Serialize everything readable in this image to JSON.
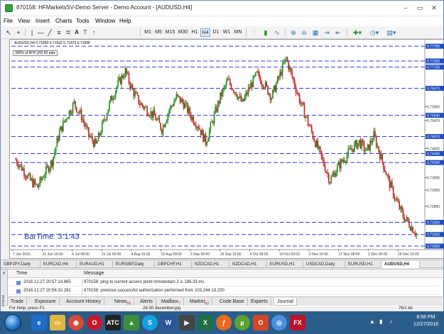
{
  "window": {
    "title": "870158: HFMarketsSV-Demo Server - Demo Account - [AUDUSD,H4]",
    "controls": [
      "–",
      "▭",
      "✕"
    ]
  },
  "menu": [
    "File",
    "View",
    "Insert",
    "Charts",
    "Tools",
    "Window",
    "Help"
  ],
  "toolbar": {
    "timeframes": [
      "M1",
      "M5",
      "M15",
      "M30",
      "H1",
      "H4",
      "D1",
      "W1",
      "MN"
    ],
    "active_timeframe": "H4"
  },
  "chart": {
    "symbol_info": "AUDUSD,H4  0.71890 0.71932 0.71873 0.71898",
    "indicator_label": "300% of ATR (20)   60 pips",
    "bartime_label": "BarTime: 3:1:43",
    "price_labels": [
      "0.77780",
      "0.77320",
      "0.77130",
      "0.76470",
      "0.75900",
      "0.75630",
      "0.75470",
      "0.74970",
      "0.74600",
      "0.74440",
      "0.74160",
      "0.73690",
      "0.73300",
      "0.72800",
      "0.72300",
      "0.71920",
      "0.71560"
    ],
    "highlighted_prices": [
      "0.77780",
      "0.77320",
      "0.77130",
      "0.76470",
      "0.75630",
      "0.74970",
      "0.74440",
      "0.74160",
      "0.72300",
      "0.71920",
      "0.71560"
    ],
    "date_labels": [
      "7 Jun 2016",
      "21 Jun 16:00",
      "6 Jul 08:00",
      "21 Jul 00:00",
      "4 Aug 16:00",
      "19 Aug 08:00",
      "5 Sep 00:00",
      "19 Sep 16:00",
      "4 Oct 08:00",
      "19 Oct 00:00",
      "2 Nov 16:00",
      "17 Nov 08:00",
      "1 Dec 00:00",
      "16 Dec 16:00"
    ],
    "colors": {
      "up_candle": "#1a8c1a",
      "down_candle": "#c22222",
      "level_line": "#3a3ad6",
      "price_highlight": "#1f4fbf"
    },
    "chart_data": {
      "type": "candlestick",
      "symbol": "AUDUSD",
      "timeframe": "H4",
      "x_tick_labels": [
        "7 Jun 2016",
        "21 Jun 16:00",
        "6 Jul 08:00",
        "21 Jul 00:00",
        "4 Aug 16:00",
        "19 Aug 08:00",
        "5 Sep 00:00",
        "19 Sep 16:00",
        "4 Oct 08:00",
        "19 Oct 00:00",
        "2 Nov 16:00",
        "17 Nov 08:00",
        "1 Dec 00:00",
        "16 Dec 16:00"
      ],
      "ylim": [
        0.7145,
        0.7785
      ],
      "approx_close_path": [
        0.7425,
        0.7395,
        0.736,
        0.734,
        0.7385,
        0.742,
        0.751,
        0.756,
        0.76,
        0.756,
        0.75,
        0.747,
        0.754,
        0.761,
        0.766,
        0.77,
        0.764,
        0.76,
        0.758,
        0.756,
        0.752,
        0.758,
        0.762,
        0.76,
        0.756,
        0.753,
        0.748,
        0.755,
        0.762,
        0.767,
        0.764,
        0.76,
        0.765,
        0.769,
        0.766,
        0.762,
        0.768,
        0.774,
        0.767,
        0.76,
        0.754,
        0.748,
        0.742,
        0.736,
        0.74,
        0.743,
        0.746,
        0.748,
        0.745,
        0.75,
        0.743,
        0.736,
        0.73,
        0.725,
        0.722,
        0.719
      ],
      "horizontal_levels": [
        0.7778,
        0.7732,
        0.7713,
        0.7647,
        0.7563,
        0.7497,
        0.7444,
        0.7416,
        0.723,
        0.7192,
        0.7156
      ]
    }
  },
  "symbol_tabs": [
    "GBPJPY,Daily",
    "EURCAD,H4",
    "EURAUD,H1",
    "EURGBP,Daily",
    "GBPCHF,H1",
    "NZDCAD,H1",
    "NZDCAD,H1",
    "EURUSD,H1",
    "USDCAD,Daily",
    "EURUSD,H1",
    "AUDUSD,H4"
  ],
  "active_symbol_tab": "AUDUSD,H4",
  "terminal": {
    "side_label": "Terminal",
    "headers": {
      "time": "Time",
      "message": "Message"
    },
    "rows": [
      {
        "time": "2016.12.27 20:57:14.665",
        "message": "870158: ping to current access point Amsterdam 2 is 186.33 ms"
      },
      {
        "time": "2016.12.27 20:56:32.281",
        "message": "870158: previous successful authorization performed from 103.244.13.230"
      }
    ],
    "tabs": [
      {
        "label": "Trade",
        "badge": ""
      },
      {
        "label": "Exposure",
        "badge": ""
      },
      {
        "label": "Account History",
        "badge": ""
      },
      {
        "label": "News",
        "badge": "99"
      },
      {
        "label": "Alerts",
        "badge": ""
      },
      {
        "label": "Mailbox",
        "badge": "7"
      },
      {
        "label": "Market",
        "badge": "63"
      },
      {
        "label": "Code Base",
        "badge": ""
      },
      {
        "label": "Experts",
        "badge": ""
      },
      {
        "label": "Journal",
        "badge": ""
      }
    ],
    "active_tab": "Journal"
  },
  "status": {
    "help": "For Help, press F1",
    "middle": "26-30 december.jpg",
    "right": "76/1 kb"
  },
  "taskbar": {
    "time": "8:58 PM",
    "date": "12/27/2016",
    "apps": [
      "IE",
      "Folder",
      "Chrome",
      "Opera",
      "ATC",
      "MT4",
      "Skype",
      "Word",
      "Media",
      "Excel",
      "Firefox",
      "uTorrent",
      "Office",
      "Chrome2",
      "FXPRO"
    ]
  }
}
